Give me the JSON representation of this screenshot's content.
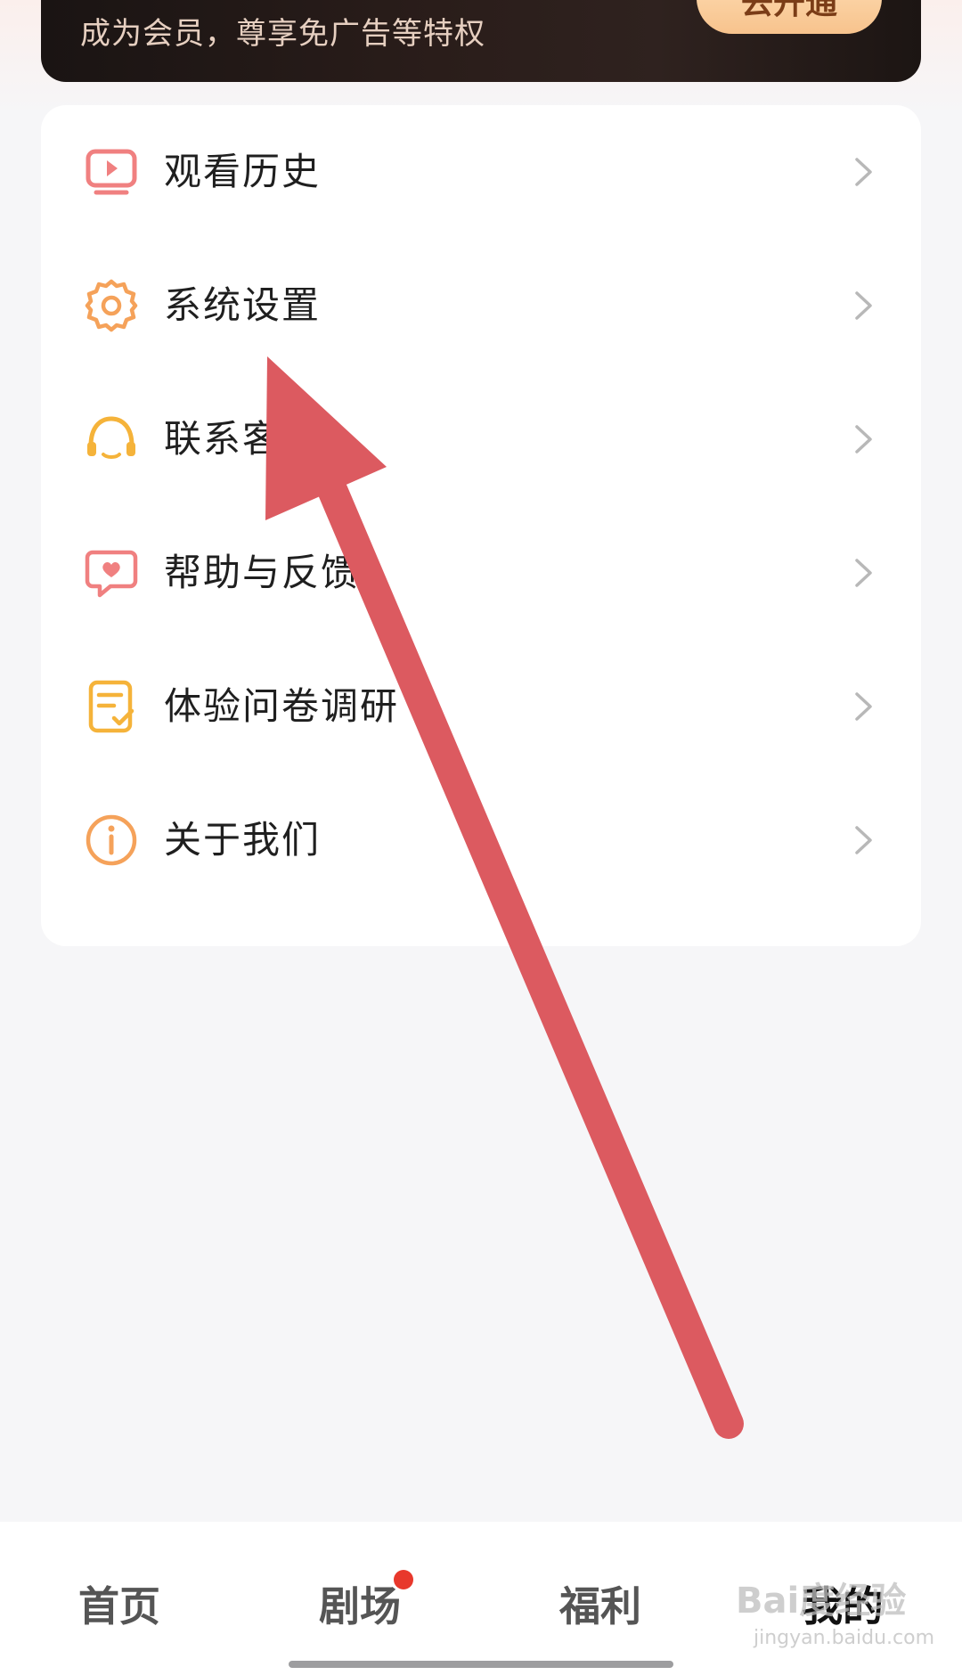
{
  "vip": {
    "subtitle": "成为会员，尊享免广告等特权",
    "button_label": "去开通"
  },
  "menu": {
    "items": [
      {
        "label": "观看历史",
        "icon": "tv-history-icon"
      },
      {
        "label": "系统设置",
        "icon": "gear-icon"
      },
      {
        "label": "联系客服",
        "icon": "headset-icon"
      },
      {
        "label": "帮助与反馈",
        "icon": "chat-heart-icon"
      },
      {
        "label": "体验问卷调研",
        "icon": "survey-icon"
      },
      {
        "label": "关于我们",
        "icon": "info-icon"
      }
    ]
  },
  "tabbar": {
    "tabs": [
      {
        "label": "首页",
        "active": false
      },
      {
        "label": "剧场",
        "active": false,
        "badge_dot": true
      },
      {
        "label": "福利",
        "active": false
      },
      {
        "label": "我的",
        "active": true
      }
    ]
  },
  "watermark": {
    "brand": "Bai度经验",
    "url": "jingyan.baidu.com"
  },
  "colors": {
    "icon_pink": "#f08080",
    "icon_orange": "#f5a25a",
    "icon_yellow": "#f5b33a",
    "arrow": "#dc5a60",
    "badge": "#e8382c"
  }
}
